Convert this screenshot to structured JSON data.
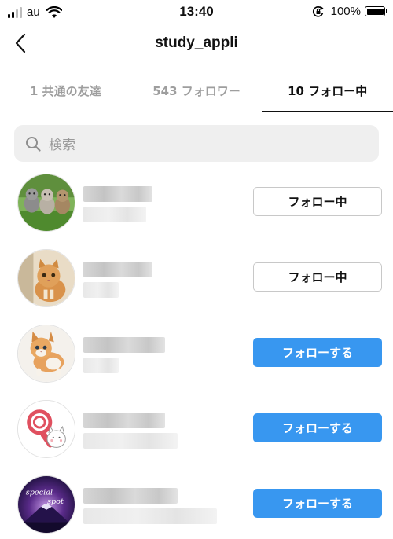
{
  "status_bar": {
    "carrier": "au",
    "time": "13:40",
    "battery": "100%",
    "icons": [
      "signal-icon",
      "wifi-icon",
      "rotation-lock-icon",
      "battery-icon"
    ]
  },
  "header": {
    "title": "study_appli",
    "back_icon": "chevron-left-icon"
  },
  "tabs": [
    {
      "label": "1 共通の友達",
      "active": false
    },
    {
      "label": "543 フォロワー",
      "active": false
    },
    {
      "label": "10 フォロー中",
      "active": true
    }
  ],
  "search": {
    "placeholder": "検索",
    "icon": "search-icon"
  },
  "users": [
    {
      "avatar": "kittens-on-grass",
      "button_label": "フォロー中",
      "following": true
    },
    {
      "avatar": "orange-cat",
      "button_label": "フォロー中",
      "following": true
    },
    {
      "avatar": "kitten-walking",
      "button_label": "フォローする",
      "following": false
    },
    {
      "avatar": "cat-with-magnifier-logo",
      "button_label": "フォローする",
      "following": false
    },
    {
      "avatar": "special-spot-logo",
      "button_label": "フォローする",
      "following": false
    }
  ],
  "colors": {
    "accent": "#3897f0",
    "inactive_tab": "#9e9e9e",
    "search_bg": "#efefef"
  }
}
